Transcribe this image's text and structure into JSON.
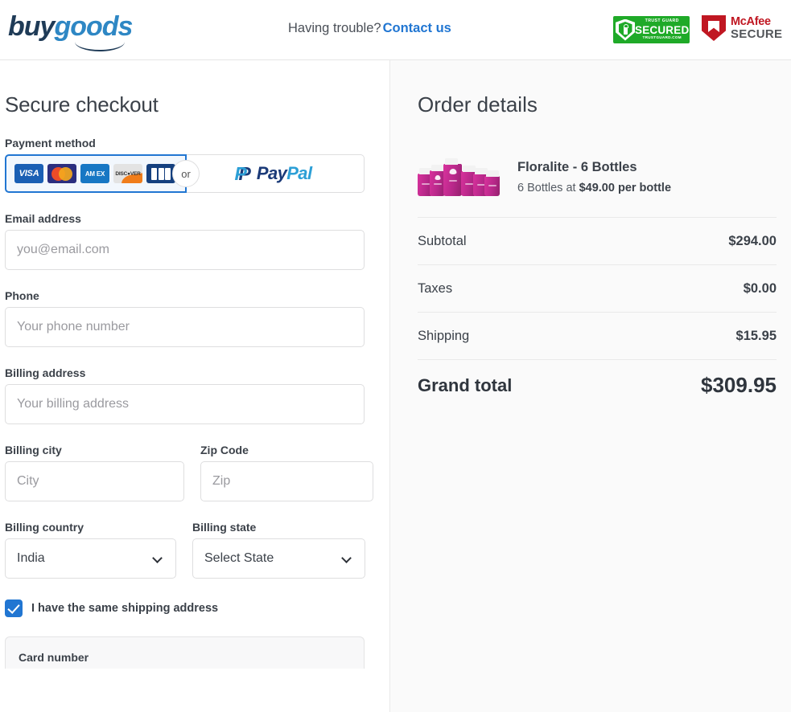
{
  "header": {
    "logo": {
      "part1": "buy",
      "part2": "goods"
    },
    "help_text": "Having trouble?",
    "contact_link": "Contact us",
    "trust_guard": {
      "top": "TRUST GUARD",
      "main": "SECURED",
      "bottom": "TRUSTGUARD.COM"
    },
    "mcafee": {
      "line1": "McAfee",
      "line2": "SECURE"
    }
  },
  "checkout": {
    "title": "Secure checkout",
    "payment_method": {
      "label": "Payment method",
      "cards": [
        "VISA",
        "Mastercard",
        "AMEX",
        "DISCOVER",
        "JCB"
      ],
      "or_text": "or",
      "paypal_label": "PayPal",
      "paypal_part1": "Pay",
      "paypal_part2": "Pal",
      "selected": "card"
    },
    "fields": {
      "email": {
        "label": "Email address",
        "placeholder": "you@email.com",
        "value": ""
      },
      "phone": {
        "label": "Phone",
        "placeholder": "Your phone number",
        "value": ""
      },
      "billing_address": {
        "label": "Billing address",
        "placeholder": "Your billing address",
        "value": ""
      },
      "billing_city": {
        "label": "Billing city",
        "placeholder": "City",
        "value": ""
      },
      "zip_code": {
        "label": "Zip Code",
        "placeholder": "Zip",
        "value": ""
      },
      "billing_country": {
        "label": "Billing country",
        "value": "India"
      },
      "billing_state": {
        "label": "Billing state",
        "value": "Select State"
      }
    },
    "same_shipping": {
      "label": "I have the same shipping address",
      "checked": true
    },
    "card_section": {
      "card_number_label": "Card number"
    }
  },
  "order": {
    "title": "Order details",
    "product": {
      "name": "Floralite - 6 Bottles",
      "qty_text": "6 Bottles at ",
      "unit_price_text": "$49.00 per bottle"
    },
    "rows": [
      {
        "label": "Subtotal",
        "value": "$294.00"
      },
      {
        "label": "Taxes",
        "value": "$0.00"
      },
      {
        "label": "Shipping",
        "value": "$15.95"
      }
    ],
    "grand_total": {
      "label": "Grand total",
      "value": "$309.95"
    }
  },
  "colors": {
    "accent_blue": "#2176d2",
    "logo_dark": "#1f3b57",
    "logo_light": "#2e87c4",
    "trust_green": "#1faa28",
    "mcafee_red": "#c01722",
    "product_pink": "#c8289a"
  }
}
